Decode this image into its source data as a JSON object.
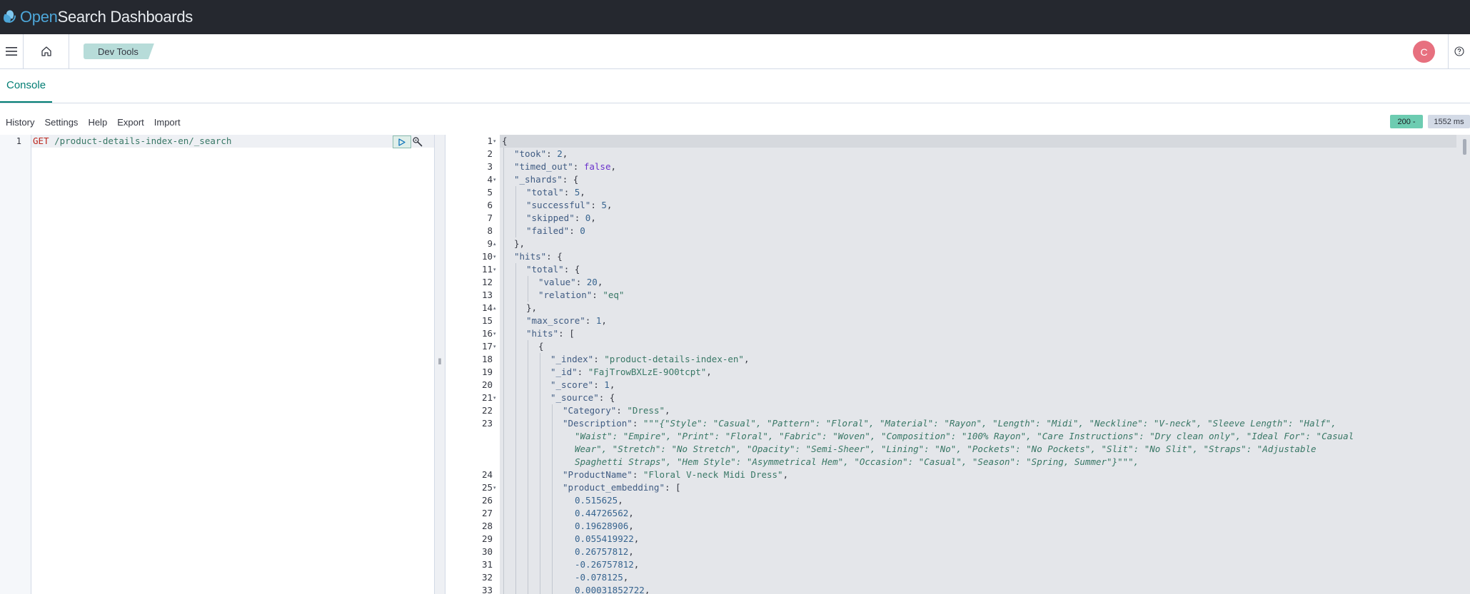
{
  "app": {
    "logo_prefix": "Open",
    "logo_suffix": "Search Dashboards",
    "breadcrumb": "Dev Tools",
    "avatar_initial": "C"
  },
  "tabs": [
    "Console"
  ],
  "toolbar": {
    "items": [
      "History",
      "Settings",
      "Help",
      "Export",
      "Import"
    ],
    "status": "200 -",
    "time": "1552 ms"
  },
  "request": {
    "line_number": "1",
    "method": "GET",
    "path": "/product-details-index-en/_search"
  },
  "response": {
    "lines": [
      {
        "n": "1",
        "fold": "▾",
        "depth": 0,
        "text": "{"
      },
      {
        "n": "2",
        "fold": "",
        "depth": 1,
        "text": "\"took\": 2,"
      },
      {
        "n": "3",
        "fold": "",
        "depth": 1,
        "text": "\"timed_out\": false,"
      },
      {
        "n": "4",
        "fold": "▾",
        "depth": 1,
        "text": "\"_shards\": {"
      },
      {
        "n": "5",
        "fold": "",
        "depth": 2,
        "text": "\"total\": 5,"
      },
      {
        "n": "6",
        "fold": "",
        "depth": 2,
        "text": "\"successful\": 5,"
      },
      {
        "n": "7",
        "fold": "",
        "depth": 2,
        "text": "\"skipped\": 0,"
      },
      {
        "n": "8",
        "fold": "",
        "depth": 2,
        "text": "\"failed\": 0"
      },
      {
        "n": "9",
        "fold": "▴",
        "depth": 1,
        "text": "},"
      },
      {
        "n": "10",
        "fold": "▾",
        "depth": 1,
        "text": "\"hits\": {"
      },
      {
        "n": "11",
        "fold": "▾",
        "depth": 2,
        "text": "\"total\": {"
      },
      {
        "n": "12",
        "fold": "",
        "depth": 3,
        "text": "\"value\": 20,"
      },
      {
        "n": "13",
        "fold": "",
        "depth": 3,
        "text": "\"relation\": \"eq\""
      },
      {
        "n": "14",
        "fold": "▴",
        "depth": 2,
        "text": "},"
      },
      {
        "n": "15",
        "fold": "",
        "depth": 2,
        "text": "\"max_score\": 1,"
      },
      {
        "n": "16",
        "fold": "▾",
        "depth": 2,
        "text": "\"hits\": ["
      },
      {
        "n": "17",
        "fold": "▾",
        "depth": 3,
        "text": "{"
      },
      {
        "n": "18",
        "fold": "",
        "depth": 4,
        "text": "\"_index\": \"product-details-index-en\","
      },
      {
        "n": "19",
        "fold": "",
        "depth": 4,
        "text": "\"_id\": \"FajTrowBXLzE-9O0tcpt\","
      },
      {
        "n": "20",
        "fold": "",
        "depth": 4,
        "text": "\"_score\": 1,"
      },
      {
        "n": "21",
        "fold": "▾",
        "depth": 4,
        "text": "\"_source\": {"
      },
      {
        "n": "22",
        "fold": "",
        "depth": 5,
        "text": "\"Category\": \"Dress\","
      },
      {
        "n": "23",
        "fold": "",
        "depth": 5,
        "text": "\"Description\": \"\"\"{\"Style\": \"Casual\", \"Pattern\": \"Floral\", \"Material\": \"Rayon\", \"Length\": \"Midi\", \"Neckline\": \"V-neck\", \"Sleeve Length\": \"Half\","
      },
      {
        "n": "",
        "fold": "",
        "depth": 6,
        "text": "\"Waist\": \"Empire\", \"Print\": \"Floral\", \"Fabric\": \"Woven\", \"Composition\": \"100% Rayon\", \"Care Instructions\": \"Dry clean only\", \"Ideal For\": \"Casual"
      },
      {
        "n": "",
        "fold": "",
        "depth": 6,
        "text": "Wear\", \"Stretch\": \"No Stretch\", \"Opacity\": \"Semi-Sheer\", \"Lining\": \"No\", \"Pockets\": \"No Pockets\", \"Slit\": \"No Slit\", \"Straps\": \"Adjustable"
      },
      {
        "n": "",
        "fold": "",
        "depth": 6,
        "text": "Spaghetti Straps\", \"Hem Style\": \"Asymmetrical Hem\", \"Occasion\": \"Casual\", \"Season\": \"Spring, Summer\"}\"\"\","
      },
      {
        "n": "24",
        "fold": "",
        "depth": 5,
        "text": "\"ProductName\": \"Floral V-neck Midi Dress\","
      },
      {
        "n": "25",
        "fold": "▾",
        "depth": 5,
        "text": "\"product_embedding\": ["
      },
      {
        "n": "26",
        "fold": "",
        "depth": 6,
        "text": "0.515625,"
      },
      {
        "n": "27",
        "fold": "",
        "depth": 6,
        "text": "0.44726562,"
      },
      {
        "n": "28",
        "fold": "",
        "depth": 6,
        "text": "0.19628906,"
      },
      {
        "n": "29",
        "fold": "",
        "depth": 6,
        "text": "0.055419922,"
      },
      {
        "n": "30",
        "fold": "",
        "depth": 6,
        "text": "0.26757812,"
      },
      {
        "n": "31",
        "fold": "",
        "depth": 6,
        "text": "-0.26757812,"
      },
      {
        "n": "32",
        "fold": "",
        "depth": 6,
        "text": "-0.078125,"
      },
      {
        "n": "33",
        "fold": "",
        "depth": 6,
        "text": "0.00031852722,"
      }
    ]
  },
  "colors": {
    "header_bg": "#25282f",
    "accent": "#017d73",
    "breadcrumb_bg": "#b7dcd9",
    "avatar_bg": "#e7707f",
    "status_bg": "#6dccb1"
  }
}
